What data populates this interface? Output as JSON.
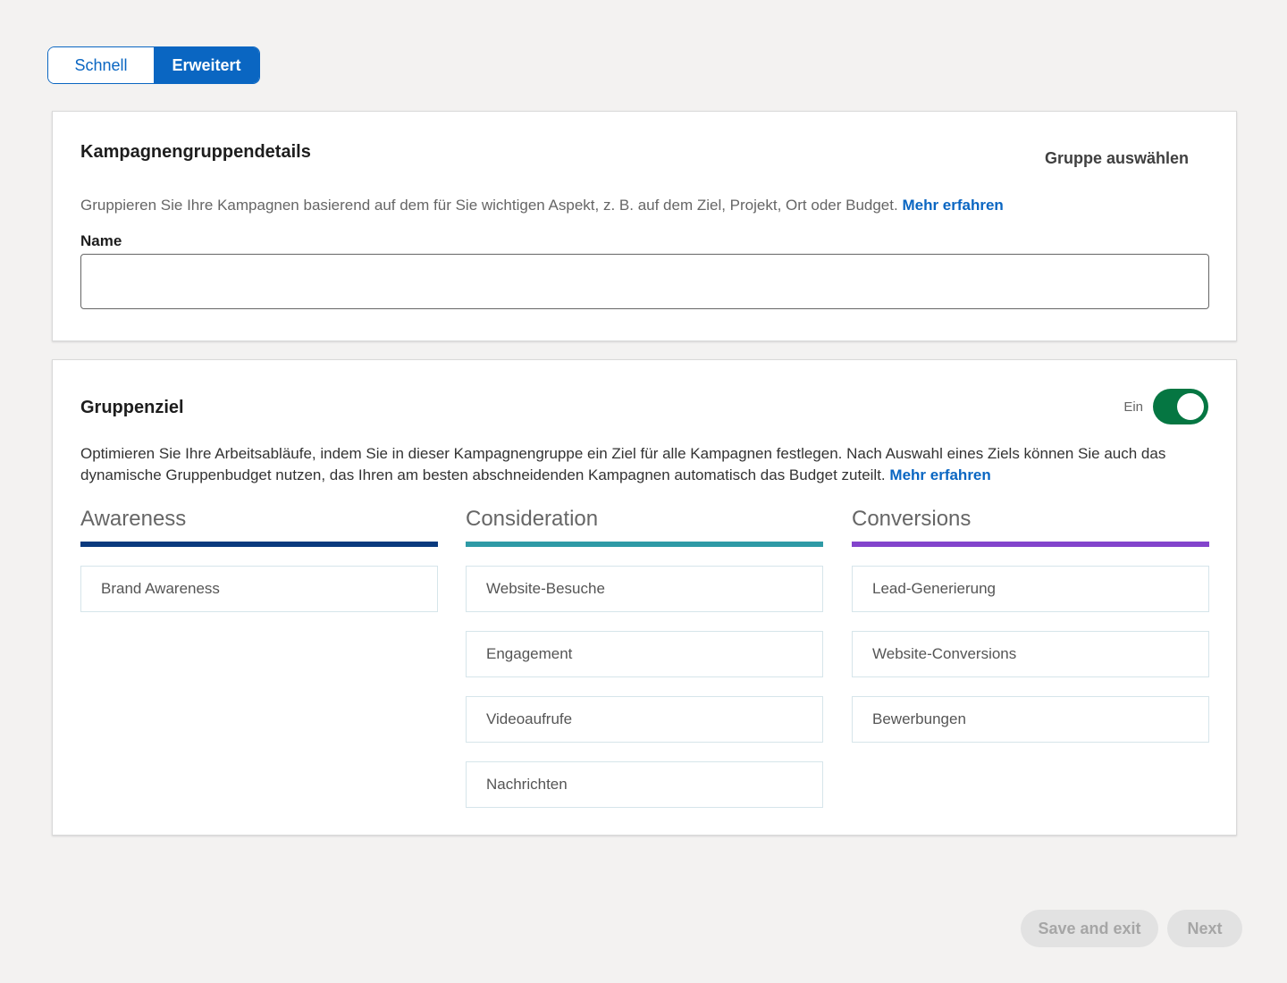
{
  "mode_toggle": {
    "quick_label": "Schnell",
    "advanced_label": "Erweitert",
    "selected": "Erweitert"
  },
  "details_card": {
    "title": "Kampagnengruppendetails",
    "select_group_label": "Gruppe auswählen",
    "helper_text": "Gruppieren Sie Ihre Kampagnen basierend auf dem für Sie wichtigen Aspekt, z. B. auf dem Ziel, Projekt, Ort oder Budget.",
    "learn_more": "Mehr erfahren",
    "name_label": "Name",
    "name_value": "",
    "name_placeholder": ""
  },
  "goal_card": {
    "title": "Gruppenziel",
    "switch_label": "Ein",
    "switch_on": true,
    "description": "Optimieren Sie Ihre Arbeitsabläufe, indem Sie in dieser Kampagnengruppe ein Ziel für alle Kampagnen festlegen. Nach Auswahl eines Ziels können Sie auch das dynamische Gruppenbudget nutzen, das Ihren am besten abschneidenden Kampagnen automatisch das Budget zuteilt.",
    "learn_more": "Mehr erfahren",
    "columns": [
      {
        "heading": "Awareness",
        "color": "#0a3a7e",
        "options": [
          "Brand Awareness"
        ]
      },
      {
        "heading": "Consideration",
        "color": "#2e9aa6",
        "options": [
          "Website-Besuche",
          "Engagement",
          "Videoaufrufe",
          "Nachrichten"
        ]
      },
      {
        "heading": "Conversions",
        "color": "#8344cc",
        "options": [
          "Lead-Generierung",
          "Website-Conversions",
          "Bewerbungen"
        ]
      }
    ]
  },
  "footer": {
    "save_exit_label": "Save and exit",
    "next_label": "Next"
  },
  "colors": {
    "accent": "#0a66c2",
    "switch_on": "#057642",
    "background": "#f3f2f1"
  }
}
